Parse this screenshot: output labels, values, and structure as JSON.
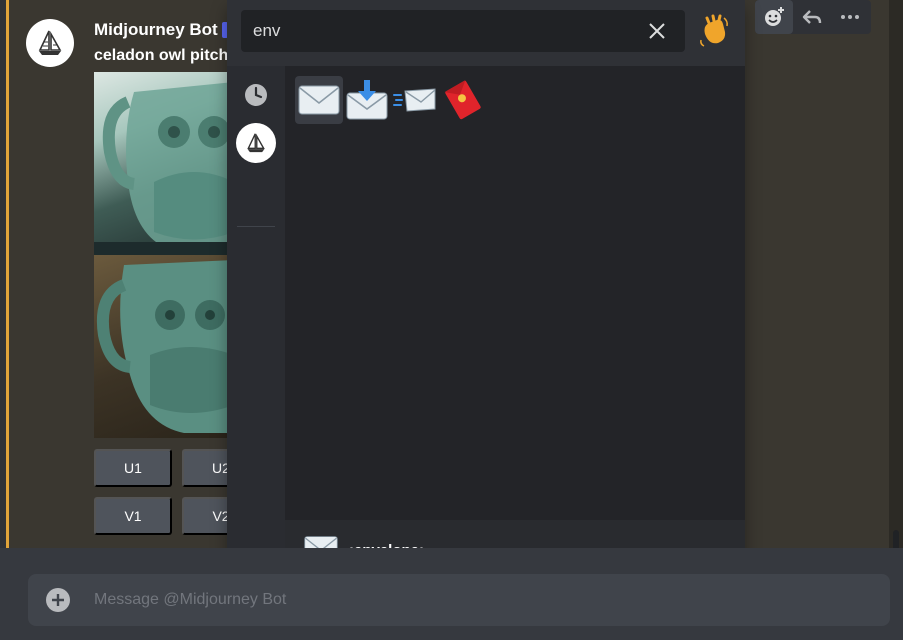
{
  "message": {
    "author": "Midjourney Bot",
    "prompt_text": "celadon owl pitcher",
    "buttons": [
      "U1",
      "U2",
      "V1",
      "V2"
    ]
  },
  "emoji_picker": {
    "search_value": "env",
    "results": [
      {
        "icon": "envelope-icon",
        "name": "envelope"
      },
      {
        "icon": "envelope-with-arrow-icon",
        "name": "envelope_with_arrow"
      },
      {
        "icon": "incoming-envelope-icon",
        "name": "incoming_envelope"
      },
      {
        "icon": "red-envelope-icon",
        "name": "red_envelope"
      }
    ],
    "preview_name": ":envelope:"
  },
  "composer": {
    "placeholder": "Message @Midjourney Bot"
  },
  "colors": {
    "accent": "#e0a33a",
    "brand": "#5865f2",
    "button": "#4f545c"
  }
}
